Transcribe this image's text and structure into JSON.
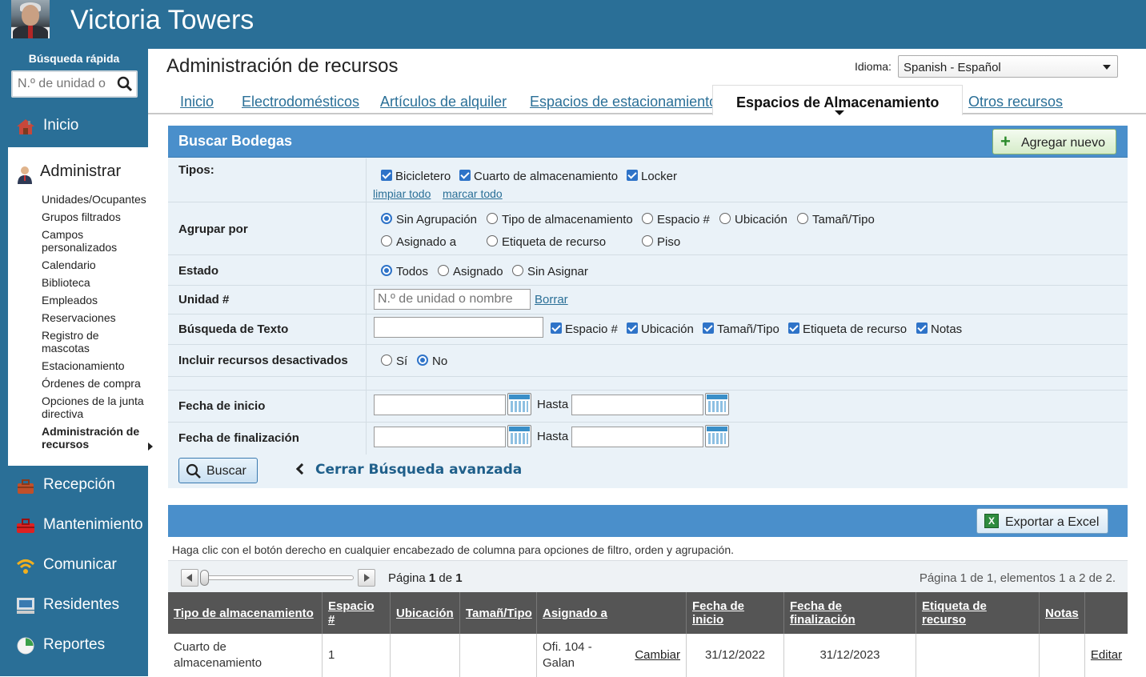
{
  "header": {
    "title": "Victoria Towers"
  },
  "sidebar": {
    "quick_search_label": "Búsqueda rápida",
    "quick_search_placeholder": "N.º de unidad o",
    "items": {
      "inicio": "Inicio",
      "administrar": "Administrar",
      "recepcion": "Recepción",
      "mantenimiento": "Mantenimiento",
      "comunicar": "Comunicar",
      "residentes": "Residentes",
      "reportes": "Reportes"
    },
    "admin_sub": [
      "Unidades/Ocupantes",
      "Grupos filtrados",
      "Campos personalizados",
      "Calendario",
      "Biblioteca",
      "Empleados",
      "Reservaciones",
      "Registro de mascotas",
      "Estacionamiento",
      "Órdenes de compra",
      "Opciones de la junta directiva",
      "Administración de recursos"
    ]
  },
  "main": {
    "title": "Administración de recursos",
    "lang_label": "Idioma:",
    "lang_value": "Spanish - Español",
    "tabs": [
      "Inicio",
      "Electrodomésticos",
      "Artículos de alquiler",
      "Espacios de estacionamiento",
      "Espacios de Almacenamiento",
      "Otros recursos"
    ]
  },
  "search": {
    "title": "Buscar Bodegas",
    "add_label": "Agregar nuevo",
    "tipos_label": "Tipos:",
    "tipos": [
      "Bicicletero",
      "Cuarto de almacenamiento",
      "Locker"
    ],
    "clear_all": "limpiar todo",
    "mark_all": "marcar todo",
    "group_label": "Agrupar por",
    "group_opts": [
      "Sin Agrupación",
      "Tipo de almacenamiento",
      "Espacio #",
      "Ubicación",
      "Tamañ/Tipo",
      "Asignado a",
      "Etiqueta de recurso",
      "Piso"
    ],
    "estado_label": "Estado",
    "estado_opts": [
      "Todos",
      "Asignado",
      "Sin Asignar"
    ],
    "unidad_label": "Unidad #",
    "unidad_placeholder": "N.º de unidad o nombre",
    "borrar": "Borrar",
    "text_label": "Búsqueda de Texto",
    "text_fields": [
      "Espacio #",
      "Ubicación",
      "Tamañ/Tipo",
      "Etiqueta de recurso",
      "Notas"
    ],
    "inactive_label": "Incluir recursos desactivados",
    "inactive_opts": [
      "Sí",
      "No"
    ],
    "start_label": "Fecha de inicio",
    "end_label": "Fecha de finalización",
    "hasta": "Hasta",
    "buscar": "Buscar",
    "close_adv": "Cerrar Búsqueda avanzada"
  },
  "results": {
    "export": "Exportar a Excel",
    "hint": "Haga clic con el botón derecho en cualquier encabezado de columna para opciones de filtro, orden y agrupación.",
    "page_prefix": "Página ",
    "page_num": "1",
    "page_of": " de ",
    "page_total": "1",
    "page_info": "Página 1 de 1, elementos 1 a 2 de 2.",
    "columns": [
      "Tipo de almacenamiento",
      "Espacio #",
      "Ubicación",
      "Tamañ/Tipo",
      "Asignado a",
      "Fecha de inicio",
      "Fecha de finalización",
      "Etiqueta de recurso",
      "Notas",
      ""
    ],
    "row": {
      "tipo": "Cuarto de almacenamiento",
      "espacio": "1",
      "ubicacion": "",
      "tamano": "",
      "asignado": "Ofi. 104 - Galan",
      "cambiar": "Cambiar",
      "inicio": "31/12/2022",
      "fin": "31/12/2023",
      "etiqueta": "",
      "notas": "",
      "editar": "Editar"
    }
  }
}
